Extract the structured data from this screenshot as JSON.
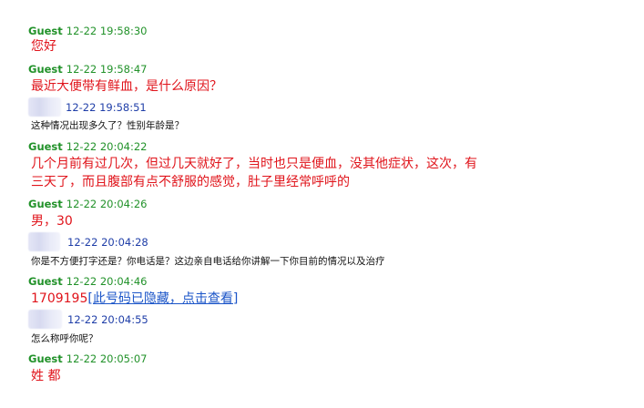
{
  "messages": [
    {
      "sender": "Guest",
      "time": "12-22 19:58:30",
      "text": "您好"
    },
    {
      "sender": "Guest",
      "time": "12-22 19:58:47",
      "text": "最近大便带有鲜血，是什么原因？"
    },
    {
      "sender": "",
      "time": "12-22 19:58:51",
      "text": "这种情况出现多久了？性别年龄是？"
    },
    {
      "sender": "Guest",
      "time": "12-22 20:04:22",
      "lines": [
        "几个月前有过几次，但过几天就好了，当时也只是便血，没其他症状，这次，有",
        "三天了，而且腹部有点不舒服的感觉，肚子里经常呼呼的"
      ]
    },
    {
      "sender": "Guest",
      "time": "12-22 20:04:26",
      "text": "男，30"
    },
    {
      "sender": "",
      "time": "12-22 20:04:28",
      "text": "你是不方便打字还是？你电话是？这边亲自电话给你讲解一下你目前的情况以及治疗"
    },
    {
      "sender": "Guest",
      "time": "12-22 20:04:46",
      "phone": "1709195",
      "link_text": "[此号码已隐藏，点击查看]"
    },
    {
      "sender": "",
      "time": "12-22 20:04:55",
      "text": "怎么称呼你呢？"
    },
    {
      "sender": "Guest",
      "time": "12-22 20:05:07",
      "text": "姓 都"
    }
  ]
}
